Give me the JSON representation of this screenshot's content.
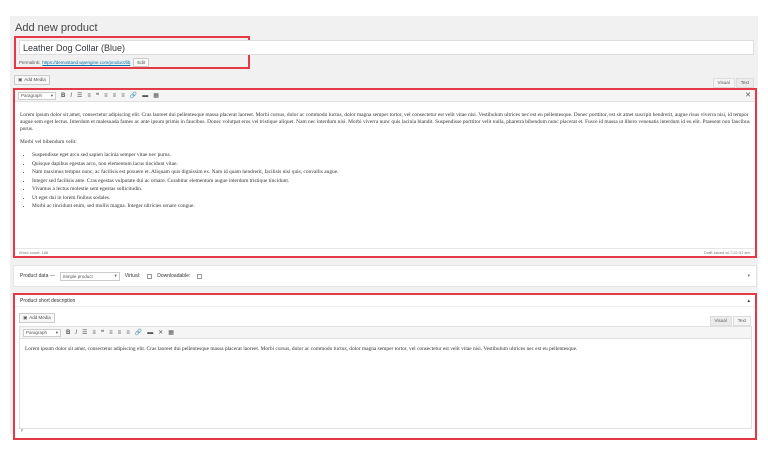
{
  "page": {
    "title": "Add new product"
  },
  "product": {
    "title": "Leather Dog Collar (Blue)",
    "permalink_label": "Permalink:",
    "permalink_url": "https://demostand.wpengine.com/product/lib",
    "edit_label": "Edit"
  },
  "editor": {
    "add_media": "Add Media",
    "tabs": {
      "visual": "Visual",
      "text": "Text"
    },
    "format": "Paragraph",
    "paragraph1": "Lorem ipsum dolor sit amet, consectetur adipiscing elit. Cras laoreet dui pellentesque massa placerat laoreet. Morbi cursus, dolor ac commodo luctus, dolor magna semper tortor, vel consectetur est velit vitae nisi. Vestibulum ultrices nec est eu pellentesque. Donec porttitor, est sit amet suscipit hendrerit, augue risus viverra nisi, id tempor augue sem eget lectus. Interdum et malesuada fames ac ante ipsum primis in faucibus. Donec volutpat eros vel tristique aliquet. Nam nec interdum nisi. Morbi viverra nunc quis lacinia blandit. Suspendisse porttitor velit nulla, pharetra bibendum nunc placerat et. Fusce id massa ut libero venenatis interdum id eu elit. Praesent non faucibus purus.",
    "paragraph2": "Morbi vel bibendum velit:",
    "list": [
      "Suspendisse eget arcu sed sapien lacinia semper vitae nec purus.",
      "Quisque dapibus egestas arcu, non elementum lacus tincidunt vitae.",
      "Nam maximus tempus nunc, ac facilisis est posuere et. Aliquam quis dignissim ex. Nam id quam hendrerit, facilisis nisi quis, convallis augue.",
      "Integer sed facilisis ante. Cras egestas vulputate dui ac ornare. Curabitur elementum augue interdum tristique tincidunt.",
      "Vivamus a lectus molestie sem egestas sollicitudin.",
      "Ut eget dui in lorem finibus sodales.",
      "Morbi ac tincidunt enim, sed mollis magna. Integer ultricies ornare congue."
    ],
    "word_count": "Word count: 166",
    "draft_saved": "Draft saved at 7:22:31 am."
  },
  "product_data": {
    "label": "Product data —",
    "type_selected": "Simple product",
    "virtual_label": "Virtual:",
    "downloadable_label": "Downloadable:"
  },
  "short_description": {
    "title": "Product short description",
    "add_media": "Add Media",
    "tabs": {
      "visual": "Visual",
      "text": "Text"
    },
    "format": "Paragraph",
    "content": "Lorem ipsum dolor sit amet, consectetur adipiscing elit. Cras laoreet dui pellentesque massa placerat laoreet. Morbi cursus, dolor ac commodo luctus, dolor magna semper tortor, vel consectetur est velit vitae nisi. Vestibulum ultrices nec est eu pellentesque.",
    "path": "p"
  },
  "icons": {
    "bold": "B",
    "italic": "I",
    "bullet": "☰",
    "numbered": "≡",
    "quote": "❝",
    "align_left": "≡",
    "align_center": "≡",
    "align_right": "≡",
    "link": "🔗",
    "more": "▬",
    "toolbar_toggle": "▦",
    "fullscreen": "✕"
  }
}
